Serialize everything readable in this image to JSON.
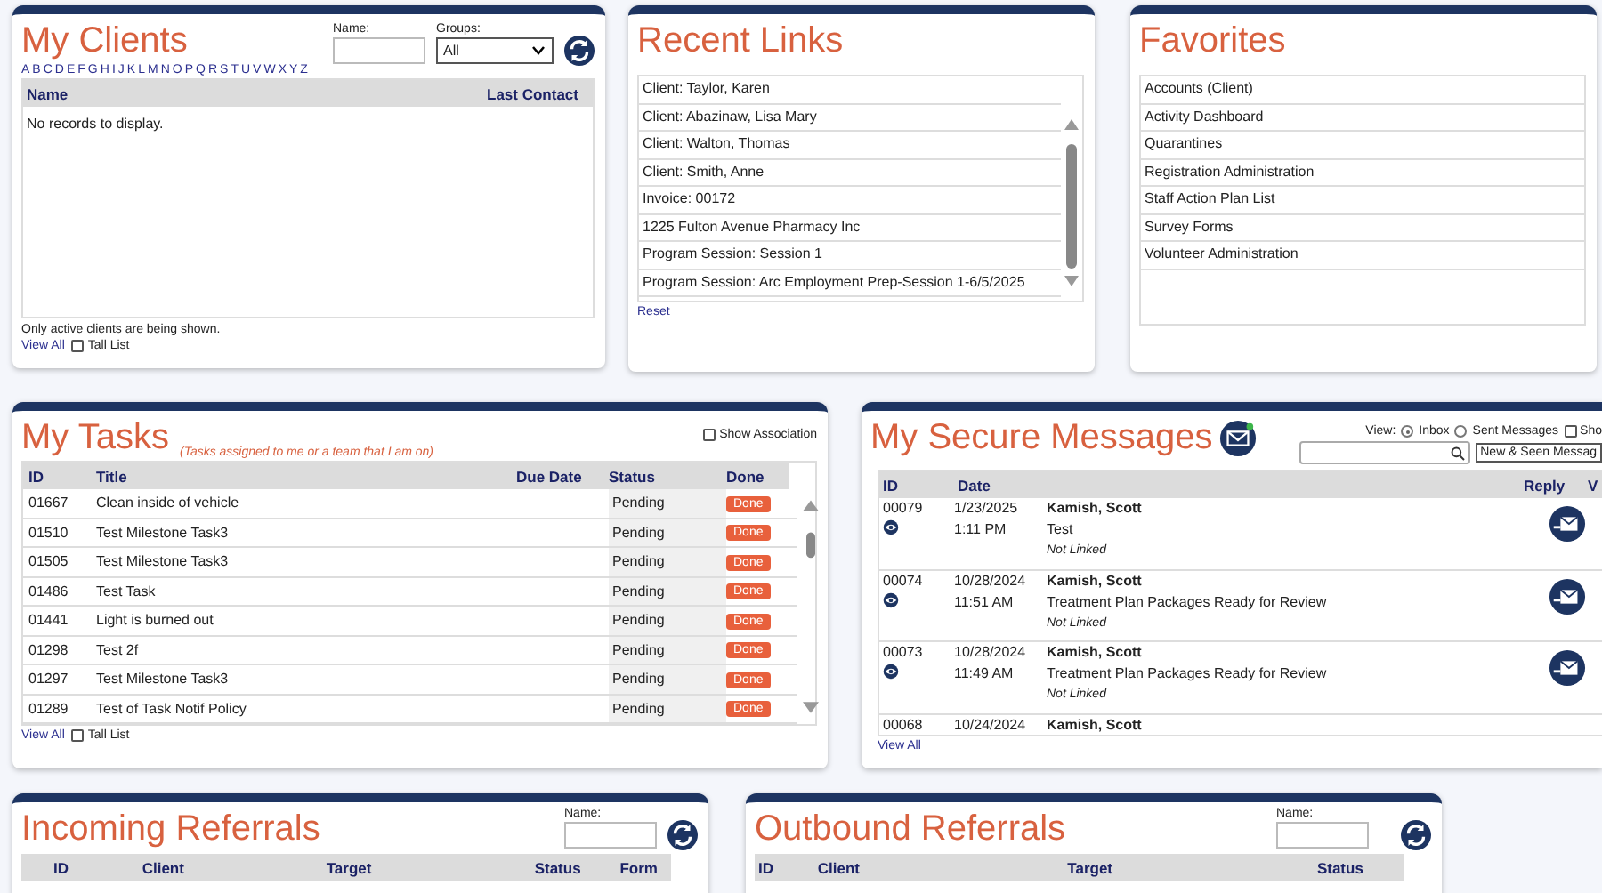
{
  "my_clients": {
    "title": "My Clients",
    "name_label": "Name:",
    "groups_label": "Groups:",
    "groups_value": "All",
    "letters": [
      "A",
      "B",
      "C",
      "D",
      "E",
      "F",
      "G",
      "H",
      "I",
      "J",
      "K",
      "L",
      "M",
      "N",
      "O",
      "P",
      "Q",
      "R",
      "S",
      "T",
      "U",
      "V",
      "W",
      "X",
      "Y",
      "Z"
    ],
    "columns": [
      "Name",
      "Last Contact"
    ],
    "empty_message": "No records to display.",
    "note": "Only active clients are being shown.",
    "view_all": "View All",
    "tall_list": {
      "label": "Tall List",
      "checked": false
    }
  },
  "recent_links": {
    "title": "Recent Links",
    "items": [
      "Client: Taylor, Karen",
      "Client: Abazinaw, Lisa Mary",
      "Client: Walton, Thomas",
      "Client: Smith, Anne",
      "Invoice: 00172",
      "1225 Fulton Avenue Pharmacy Inc",
      "Program Session: Session 1",
      "Program Session: Arc Employment Prep-Session 1-6/5/2025"
    ],
    "reset": "Reset"
  },
  "favorites": {
    "title": "Favorites",
    "items": [
      "Accounts (Client)",
      "Activity Dashboard",
      "Quarantines",
      "Registration Administration",
      "Staff Action Plan List",
      "Survey Forms",
      "Volunteer Administration"
    ]
  },
  "my_tasks": {
    "title": "My Tasks",
    "subtitle": "(Tasks assigned to me or a team that I am on)",
    "show_association": {
      "label": "Show Association",
      "checked": false
    },
    "columns": [
      "ID",
      "Title",
      "Due Date",
      "Status",
      "Done"
    ],
    "rows": [
      {
        "id": "01667",
        "title": "Clean inside of vehicle",
        "status": "Pending",
        "done": "Done"
      },
      {
        "id": "01510",
        "title": "Test Milestone Task3",
        "status": "Pending",
        "done": "Done"
      },
      {
        "id": "01505",
        "title": "Test Milestone Task3",
        "status": "Pending",
        "done": "Done"
      },
      {
        "id": "01486",
        "title": "Test Task",
        "status": "Pending",
        "done": "Done"
      },
      {
        "id": "01441",
        "title": "Light is burned out",
        "status": "Pending",
        "done": "Done"
      },
      {
        "id": "01298",
        "title": "Test 2f",
        "status": "Pending",
        "done": "Done"
      },
      {
        "id": "01297",
        "title": "Test Milestone Task3",
        "status": "Pending",
        "done": "Done"
      },
      {
        "id": "01289",
        "title": "Test of Task Notif Policy",
        "status": "Pending",
        "done": "Done"
      }
    ],
    "view_all": "View All",
    "tall_list": {
      "label": "Tall List",
      "checked": false
    }
  },
  "secure_messages": {
    "title": "My Secure Messages",
    "view_label": "View:",
    "view_options": [
      {
        "label": "Inbox",
        "selected": true
      },
      {
        "label": "Sent Messages",
        "selected": false
      }
    ],
    "show": {
      "label": "Sho",
      "checked": false
    },
    "filter": "New & Seen Messag",
    "columns": [
      "ID",
      "Date",
      "Reply",
      "V"
    ],
    "rows": [
      {
        "id": "00079",
        "date": "1/23/2025",
        "time": "1:11 PM",
        "sender": "Kamish, Scott",
        "subject": "Test",
        "link_status": "Not Linked"
      },
      {
        "id": "00074",
        "date": "10/28/2024",
        "time": "11:51 AM",
        "sender": "Kamish, Scott",
        "subject": "Treatment Plan Packages Ready for Review",
        "link_status": "Not Linked"
      },
      {
        "id": "00073",
        "date": "10/28/2024",
        "time": "11:49 AM",
        "sender": "Kamish, Scott",
        "subject": "Treatment Plan Packages Ready for Review",
        "link_status": "Not Linked"
      },
      {
        "id": "00068",
        "date": "10/24/2024",
        "sender": "Kamish, Scott"
      }
    ],
    "view_all": "View All"
  },
  "incoming_referrals": {
    "title": "Incoming Referrals",
    "name_label": "Name:",
    "columns": [
      "ID",
      "Client",
      "Target",
      "Status",
      "Form"
    ]
  },
  "outbound_referrals": {
    "title": "Outbound Referrals",
    "name_label": "Name:",
    "columns": [
      "ID",
      "Client",
      "Target",
      "Status"
    ]
  }
}
